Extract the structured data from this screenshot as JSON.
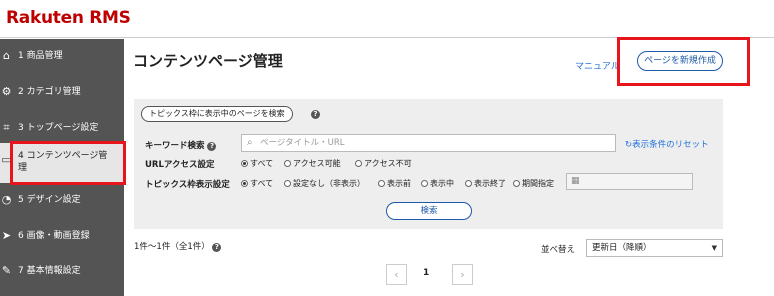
{
  "header": {
    "logo": "Rakuten RMS"
  },
  "sidebar": {
    "items": [
      {
        "label": "1 商品管理",
        "icon": "home-icon",
        "glyph": "⌂"
      },
      {
        "label": "2 カテゴリ管理",
        "icon": "gear-icon",
        "glyph": "⚙"
      },
      {
        "label": "3 トップページ設定",
        "icon": "cart-icon",
        "glyph": "⌗"
      },
      {
        "label": "4 コンテンツページ管理",
        "icon": "page-icon",
        "glyph": "▭",
        "active": true
      },
      {
        "label": "5 デザイン設定",
        "icon": "palette-icon",
        "glyph": "◔"
      },
      {
        "label": "6 画像・動画登録",
        "icon": "send-icon",
        "glyph": "➤"
      },
      {
        "label": "7 基本情報設定",
        "icon": "wrench-icon",
        "glyph": "✎"
      }
    ]
  },
  "main": {
    "title": "コンテンツページ管理",
    "manual_link": "マニュアル",
    "create_button": "ページを新規作成"
  },
  "filter": {
    "topic_chip": "トピックス枠に表示中のページを検索",
    "help_glyph": "?",
    "keyword": {
      "label": "キーワード検索",
      "placeholder": "ページタイトル・URL",
      "value": ""
    },
    "reset_link": "表示条件のリセット",
    "url_access": {
      "label": "URLアクセス設定",
      "options": [
        "すべて",
        "アクセス可能",
        "アクセス不可"
      ],
      "selected": "すべて"
    },
    "topic_display": {
      "label": "トピックス枠表示設定",
      "options": [
        "すべて",
        "設定なし（非表示）",
        "表示前",
        "表示中",
        "表示終了",
        "期間指定"
      ],
      "selected": "すべて"
    },
    "search_button": "検索"
  },
  "results": {
    "count_text": "1件〜1件（全1件）",
    "sort_label": "並べ替え",
    "sort_value": "更新日（降順）",
    "pagination": {
      "current": "1",
      "prev": "‹",
      "next": "›"
    }
  },
  "colors": {
    "brand": "#bf0000",
    "link": "#1e6fd9",
    "button_border": "#1e5aa8",
    "highlight": "#e8161c",
    "sidebar_bg": "#545454"
  }
}
